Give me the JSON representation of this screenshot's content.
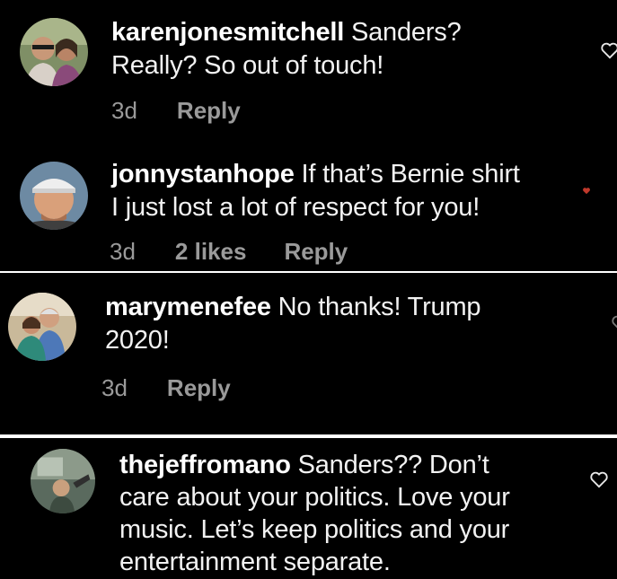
{
  "comments": [
    {
      "username": "karenjonesmitchell",
      "text_line1": " Sanders?",
      "text_line2": "Really?  So out of touch!",
      "time": "3d",
      "reply": "Reply"
    },
    {
      "username": "jonnystanhope",
      "text_line1": " If that’s Bernie shirt",
      "text_line2": "I just lost a lot of respect for you!",
      "time": "3d",
      "likes": "2 likes",
      "reply": "Reply"
    },
    {
      "username": "marymenefee",
      "text_line1": " No thanks! Trump",
      "text_line2": "2020!",
      "time": "3d",
      "reply": "Reply"
    },
    {
      "username": "thejeffromano",
      "text_line1": " Sanders?? Don’t",
      "text_line2": "care about your politics. Love your",
      "text_line3": "music. Let’s keep politics and your",
      "text_line4": "entertainment separate."
    }
  ],
  "icons": {
    "like": "heart-outline-icon",
    "liked": "heart-filled-icon"
  },
  "colors": {
    "background": "#000000",
    "text": "#f2f2f2",
    "meta": "#9a9a9a",
    "liked_heart": "#c0392b"
  }
}
